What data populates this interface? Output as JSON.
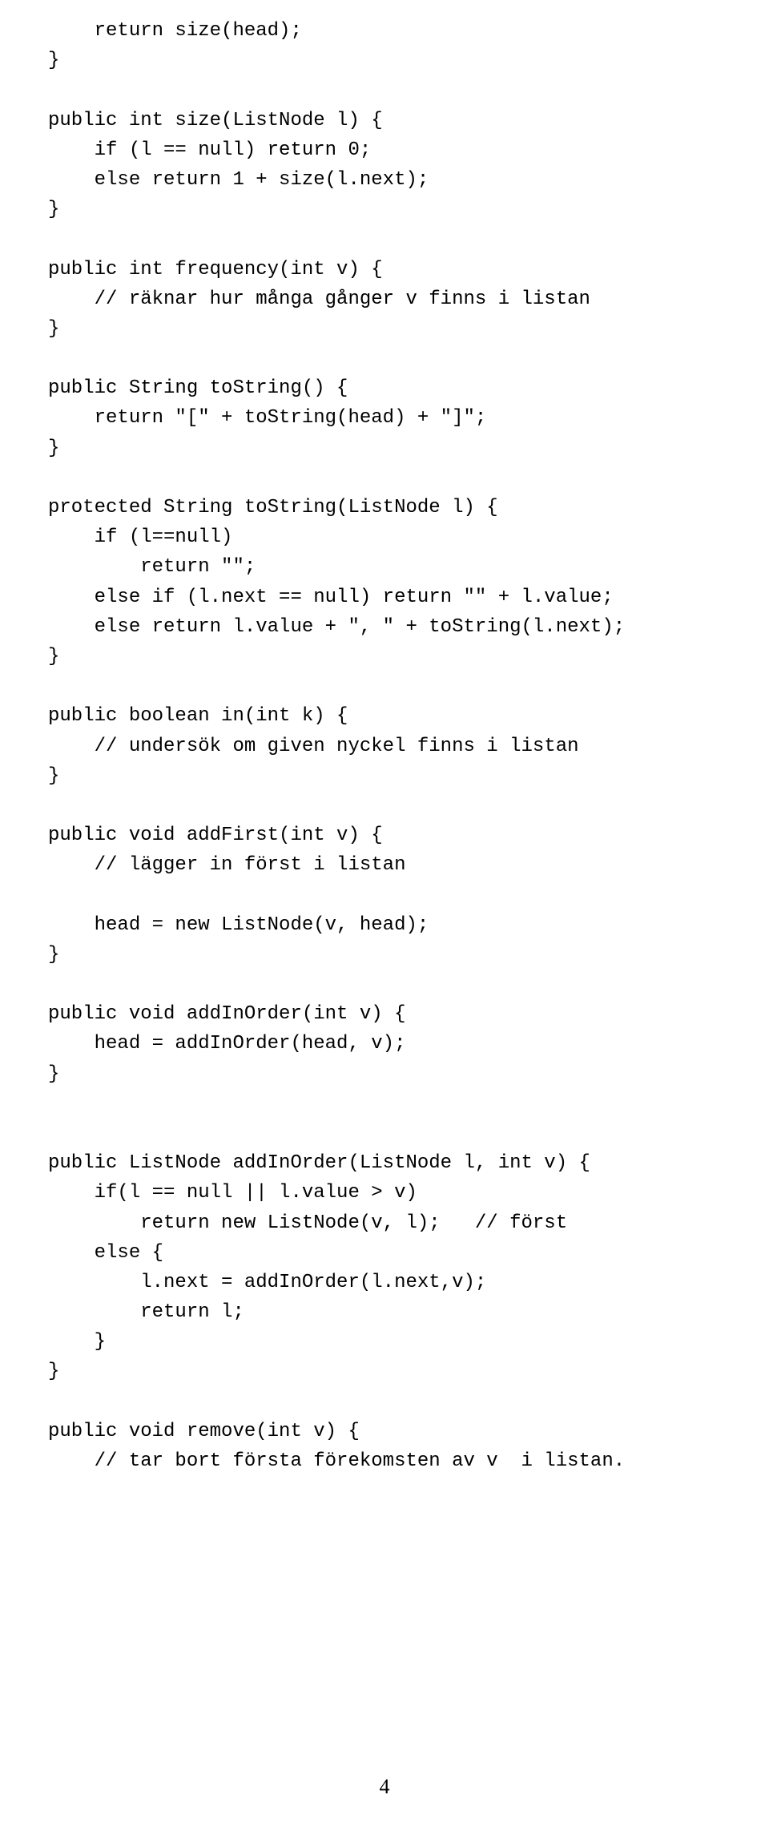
{
  "code": "    return size(head);\n}\n\npublic int size(ListNode l) {\n    if (l == null) return 0;\n    else return 1 + size(l.next);\n}\n\npublic int frequency(int v) {\n    // räknar hur många gånger v finns i listan\n}\n\npublic String toString() {\n    return \"[\" + toString(head) + \"]\";\n}\n\nprotected String toString(ListNode l) {\n    if (l==null)\n        return \"\";\n    else if (l.next == null) return \"\" + l.value;\n    else return l.value + \", \" + toString(l.next);\n}\n\npublic boolean in(int k) {\n    // undersök om given nyckel finns i listan\n}\n\npublic void addFirst(int v) {\n    // lägger in först i listan\n\n    head = new ListNode(v, head);\n}\n\npublic void addInOrder(int v) {\n    head = addInOrder(head, v);\n}\n\n\npublic ListNode addInOrder(ListNode l, int v) {\n    if(l == null || l.value > v)\n        return new ListNode(v, l);   // först\n    else {\n        l.next = addInOrder(l.next,v);\n        return l;\n    }\n}\n\npublic void remove(int v) {\n    // tar bort första förekomsten av v  i listan.",
  "pageNumber": "4"
}
